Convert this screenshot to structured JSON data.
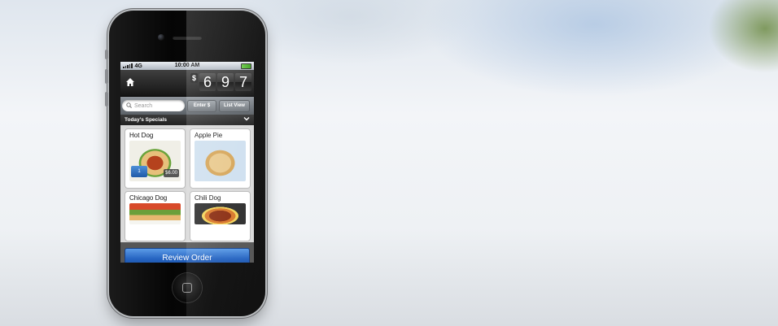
{
  "status_bar": {
    "network": "4G",
    "time": "10:00 AM"
  },
  "header": {
    "currency": "$",
    "digits": [
      "6",
      "9",
      "7"
    ]
  },
  "search": {
    "placeholder": "Search"
  },
  "buttons": {
    "enter_amount": "Enter $",
    "list_view": "List View",
    "review_order": "Review Order"
  },
  "section": {
    "title": "Today's Specials"
  },
  "items": [
    {
      "name": "Hot Dog",
      "quantity": "1",
      "price": "$6.00"
    },
    {
      "name": "Apple Pie"
    },
    {
      "name": "Chicago Dog"
    },
    {
      "name": "Chili Dog"
    }
  ],
  "icons": {
    "home": "home-icon",
    "search": "magnifier-icon",
    "chevron": "chevron-down-icon"
  },
  "colors": {
    "accent_blue": "#2563c0",
    "battery_green": "#3ea41f"
  }
}
